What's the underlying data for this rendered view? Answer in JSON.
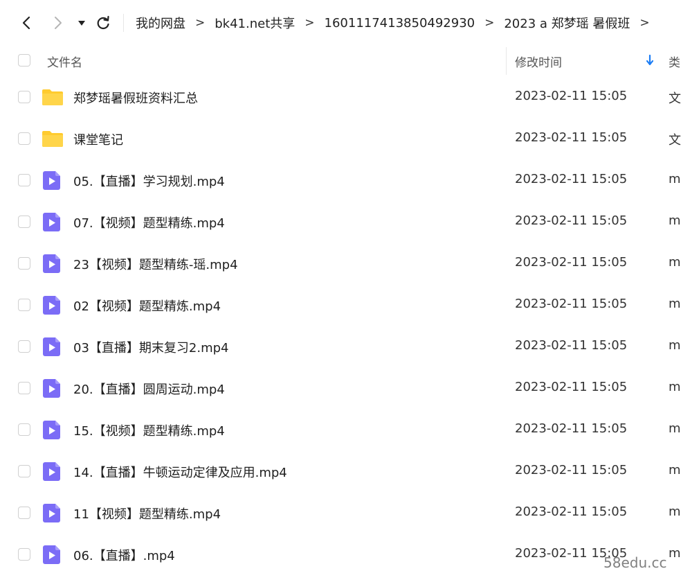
{
  "breadcrumb": {
    "items": [
      "我的网盘",
      "bk41.net共享",
      "1601117413850492930",
      "2023 a 郑梦瑶 暑假班"
    ],
    "separator": ">"
  },
  "header": {
    "name_label": "文件名",
    "time_label": "修改时间",
    "type_label": "类",
    "sort_icon": "arrow-down-icon"
  },
  "files": [
    {
      "name": "郑梦瑶暑假班资料汇总",
      "time": "2023-02-11 15:05",
      "type": "文",
      "icon": "folder"
    },
    {
      "name": "课堂笔记",
      "time": "2023-02-11 15:05",
      "type": "文",
      "icon": "folder"
    },
    {
      "name": "05.【直播】学习规划.mp4",
      "time": "2023-02-11 15:05",
      "type": "m",
      "icon": "video"
    },
    {
      "name": "07.【视频】题型精练.mp4",
      "time": "2023-02-11 15:05",
      "type": "m",
      "icon": "video"
    },
    {
      "name": "23【视频】题型精练-瑶.mp4",
      "time": "2023-02-11 15:05",
      "type": "m",
      "icon": "video"
    },
    {
      "name": "02【视频】题型精炼.mp4",
      "time": "2023-02-11 15:05",
      "type": "m",
      "icon": "video"
    },
    {
      "name": "03【直播】期末复习2.mp4",
      "time": "2023-02-11 15:05",
      "type": "m",
      "icon": "video"
    },
    {
      "name": "20.【直播】圆周运动.mp4",
      "time": "2023-02-11 15:05",
      "type": "m",
      "icon": "video"
    },
    {
      "name": "15.【视频】题型精练.mp4",
      "time": "2023-02-11 15:05",
      "type": "m",
      "icon": "video"
    },
    {
      "name": "14.【直播】牛顿运动定律及应用.mp4",
      "time": "2023-02-11 15:05",
      "type": "m",
      "icon": "video"
    },
    {
      "name": "11【视频】题型精练.mp4",
      "time": "2023-02-11 15:05",
      "type": "m",
      "icon": "video"
    },
    {
      "name": "06.【直播】.mp4",
      "time": "2023-02-11 15:05",
      "type": "m",
      "icon": "video"
    }
  ],
  "colors": {
    "folder": "#ffcb2f",
    "video": "#7b6cf6",
    "sort_arrow": "#1a7cf5"
  },
  "watermark": "58edu.cc"
}
